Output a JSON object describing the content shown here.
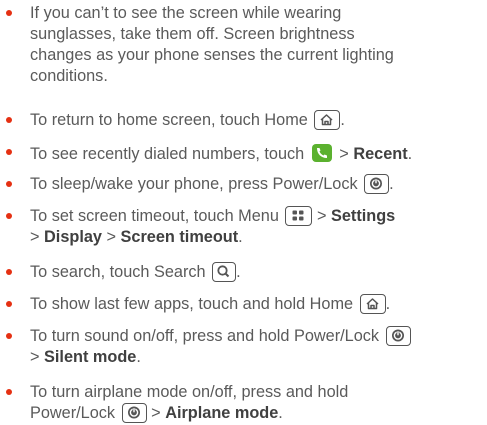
{
  "colors": {
    "bullet": "#e53012",
    "text": "#5a5a5a",
    "bold": "#404040",
    "phone_icon": "#5bb12f"
  },
  "icons": {
    "home": "home-key-icon",
    "menu": "menu-key-icon",
    "search": "search-key-icon",
    "power": "power-key-icon",
    "phone": "phone-app-icon"
  },
  "tips": [
    {
      "lines": [
        "If you can’t to see the screen while wearing",
        "sunglasses, take them off. Screen brightness",
        "changes as your phone senses the current lighting",
        "conditions."
      ]
    },
    {
      "pre": "To return to home screen, touch Home",
      "post": "."
    },
    {
      "pre": "To see recently dialed numbers, touch",
      "sep": ">",
      "bold": "Recent",
      "post": "."
    },
    {
      "pre": "To sleep/wake your phone, press Power/Lock",
      "post": "."
    },
    {
      "line1_pre": "To set screen timeout, touch Menu",
      "line1_sep": ">",
      "line1_bold": "Settings",
      "line2_sep1": ">",
      "line2_bold1": "Display",
      "line2_sep2": ">",
      "line2_bold2": "Screen timeout",
      "line2_post": "."
    },
    {
      "pre": "To search, touch Search",
      "post": "."
    },
    {
      "pre": "To show last few apps, touch and hold Home",
      "post": "."
    },
    {
      "line1_pre": "To turn sound on/off, press and hold Power/Lock",
      "line2_sep": ">",
      "line2_bold": "Silent mode",
      "line2_post": "."
    },
    {
      "line1": "To turn airplane mode on/off, press and hold",
      "line2_pre": "Power/Lock",
      "line2_sep": ">",
      "line2_bold": "Airplane mode",
      "line2_post": "."
    }
  ]
}
